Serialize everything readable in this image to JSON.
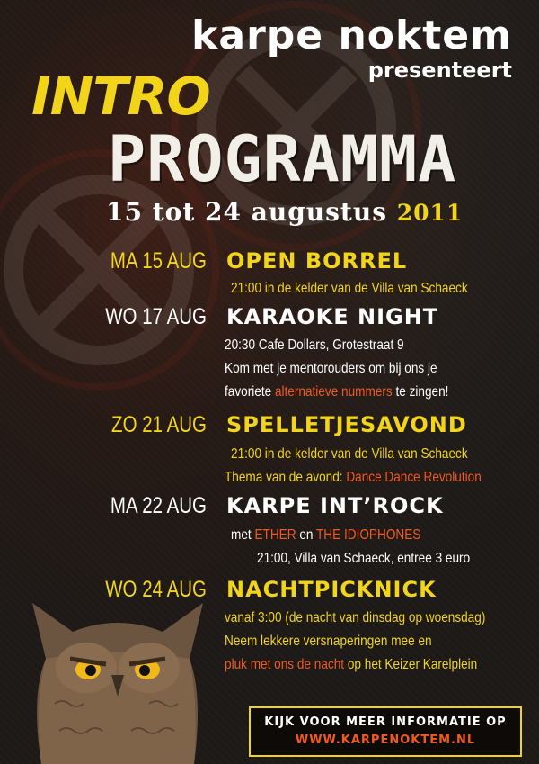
{
  "header": {
    "brand": "karpe noktem",
    "presenteert": "presenteert",
    "intro": "INTRO",
    "programma": "PROGRAMMA",
    "dates": "15 tot 24 augustus",
    "year": "2011"
  },
  "events": [
    {
      "date": "MA 15 AUG",
      "title": "OPEN BORREL",
      "lines": [
        [
          {
            "text": "21:00 in de kelder van de Villa van Schaeck",
            "color": "yellow"
          }
        ]
      ]
    },
    {
      "date": "WO 17 AUG",
      "title": "KARAOKE NIGHT",
      "lines": [
        [
          {
            "text": "20:30 Cafe Dollars, Grotestraat 9",
            "color": "white"
          }
        ],
        [
          {
            "text": "Kom met je mentorouders om bij ons je",
            "color": "white"
          }
        ],
        [
          {
            "text": "favoriete ",
            "color": "white"
          },
          {
            "text": "alternatieve nummers",
            "color": "orange"
          },
          {
            "text": " te zingen!",
            "color": "white"
          }
        ]
      ]
    },
    {
      "date": "ZO 21 AUG",
      "title": "SPELLETJESAVOND",
      "lines": [
        [
          {
            "text": "21:00 in de kelder van de Villa van Schaeck",
            "color": "yellow"
          }
        ],
        [
          {
            "text": "Thema van de avond: ",
            "color": "yellow"
          },
          {
            "text": "Dance Dance Revolution",
            "color": "orange"
          }
        ]
      ]
    },
    {
      "date": "MA 22 AUG",
      "title": "KARPE INT’ROCK",
      "lines": [
        [
          {
            "text": "met ",
            "color": "white"
          },
          {
            "text": "ETHER",
            "color": "orange"
          },
          {
            "text": " en ",
            "color": "white"
          },
          {
            "text": "THE IDIOPHONES",
            "color": "orange"
          }
        ],
        [
          {
            "text": "21:00, Villa van Schaeck, entree 3 euro",
            "color": "white"
          }
        ]
      ]
    },
    {
      "date": "WO 24 AUG",
      "title": "NACHTPICKNICK",
      "lines": [
        [
          {
            "text": "vanaf 3:00 (de nacht van dinsdag op woensdag)",
            "color": "yellow"
          }
        ],
        [
          {
            "text": "Neem lekkere versnaperingen mee en",
            "color": "yellow"
          }
        ],
        [
          {
            "text": "pluk met ons de nacht",
            "color": "orange"
          },
          {
            "text": " op het Keizer Karelplein",
            "color": "yellow"
          }
        ]
      ]
    }
  ],
  "footer": {
    "info_line1": "KIJK VOOR MEER INFORMATIE OP",
    "info_line2": "WWW.KARPENOKTEM.NL"
  },
  "colors": {
    "accent_yellow": "#f2d41a",
    "accent_orange": "#f05a22",
    "text_white": "#ffffff",
    "background": "#1c1917"
  }
}
